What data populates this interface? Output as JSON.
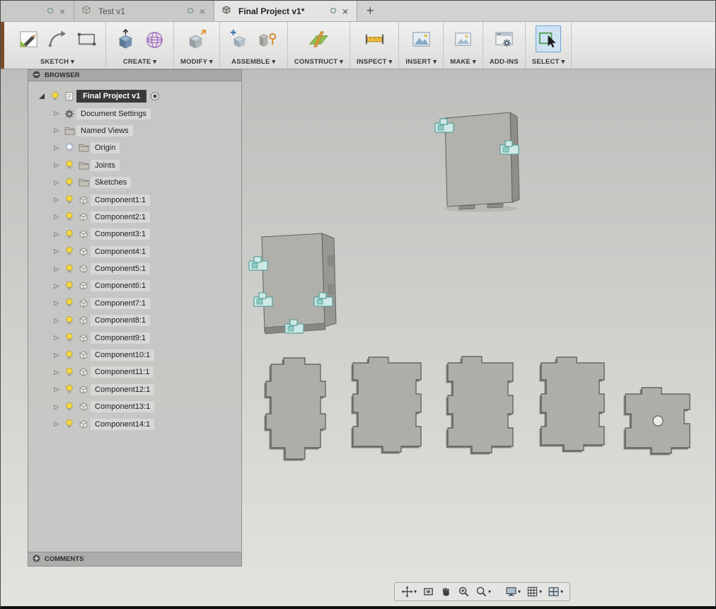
{
  "tabs": {
    "items": [
      {
        "label": "",
        "active": false
      },
      {
        "label": "Test v1",
        "active": false
      },
      {
        "label": "Final Project v1*",
        "active": true
      }
    ],
    "new_tab_label": "+"
  },
  "toolbar": {
    "groups": [
      {
        "label": "SKETCH",
        "dropdown": true,
        "icons": [
          "create-sketch-icon",
          "spline-icon",
          "rectangle-icon"
        ]
      },
      {
        "label": "CREATE",
        "dropdown": true,
        "icons": [
          "extrude-icon",
          "form-sphere-icon"
        ]
      },
      {
        "label": "MODIFY",
        "dropdown": true,
        "icons": [
          "press-pull-icon"
        ]
      },
      {
        "label": "ASSEMBLE",
        "dropdown": true,
        "icons": [
          "new-component-icon",
          "joint-icon"
        ]
      },
      {
        "label": "CONSTRUCT",
        "dropdown": true,
        "icons": [
          "construction-plane-icon"
        ]
      },
      {
        "label": "INSPECT",
        "dropdown": true,
        "icons": [
          "measure-icon"
        ]
      },
      {
        "label": "INSERT",
        "dropdown": true,
        "icons": [
          "insert-image-icon"
        ]
      },
      {
        "label": "MAKE",
        "dropdown": true,
        "icons": [
          "make-icon"
        ]
      },
      {
        "label": "ADD-INS",
        "dropdown": false,
        "icons": [
          "addins-icon"
        ]
      },
      {
        "label": "SELECT",
        "dropdown": true,
        "icons": [
          "select-icon"
        ],
        "active": true
      }
    ]
  },
  "browser": {
    "header": "BROWSER",
    "footer": "COMMENTS",
    "root": {
      "label": "Final Project v1",
      "selected": true,
      "bulb": "on",
      "icon": "document"
    },
    "items": [
      {
        "label": "Document Settings",
        "icon": "gear",
        "bulb": null
      },
      {
        "label": "Named Views",
        "icon": "folder",
        "bulb": null
      },
      {
        "label": "Origin",
        "icon": "folder",
        "bulb": "off"
      },
      {
        "label": "Joints",
        "icon": "folder",
        "bulb": "on"
      },
      {
        "label": "Sketches",
        "icon": "folder",
        "bulb": "on"
      },
      {
        "label": "Component1:1",
        "icon": "component",
        "bulb": "on"
      },
      {
        "label": "Component2:1",
        "icon": "component",
        "bulb": "on"
      },
      {
        "label": "Component3:1",
        "icon": "component",
        "bulb": "on"
      },
      {
        "label": "Component4:1",
        "icon": "component",
        "bulb": "on"
      },
      {
        "label": "Component5:1",
        "icon": "component",
        "bulb": "on"
      },
      {
        "label": "Component6:1",
        "icon": "component",
        "bulb": "on"
      },
      {
        "label": "Component7:1",
        "icon": "component",
        "bulb": "on"
      },
      {
        "label": "Component8:1",
        "icon": "component",
        "bulb": "on"
      },
      {
        "label": "Component9:1",
        "icon": "component",
        "bulb": "on"
      },
      {
        "label": "Component10:1",
        "icon": "component",
        "bulb": "on"
      },
      {
        "label": "Component11:1",
        "icon": "component",
        "bulb": "on"
      },
      {
        "label": "Component12:1",
        "icon": "component",
        "bulb": "on"
      },
      {
        "label": "Component13:1",
        "icon": "component",
        "bulb": "on"
      },
      {
        "label": "Component14:1",
        "icon": "component",
        "bulb": "on"
      }
    ]
  },
  "navbar": {
    "view_tools": [
      {
        "icon": "pan-move-icon",
        "caret": true
      },
      {
        "icon": "fit-view-icon",
        "caret": false
      },
      {
        "icon": "pan-hand-icon",
        "caret": false
      },
      {
        "icon": "zoom-in-icon",
        "caret": false
      },
      {
        "icon": "zoom-icon",
        "caret": true
      }
    ],
    "display_tools": [
      {
        "icon": "display-settings-icon",
        "caret": true
      },
      {
        "icon": "grid-layout-icon",
        "caret": true
      },
      {
        "icon": "viewports-icon",
        "caret": true
      }
    ]
  },
  "colors": {
    "accent_select": "#6fa3d8",
    "joint_marker": "#cfe9e6",
    "joint_marker_stroke": "#56a09a",
    "selected_row_bg": "#3a3a38",
    "canvas_top": "#bebebc",
    "canvas_bottom": "#e2e2df"
  }
}
